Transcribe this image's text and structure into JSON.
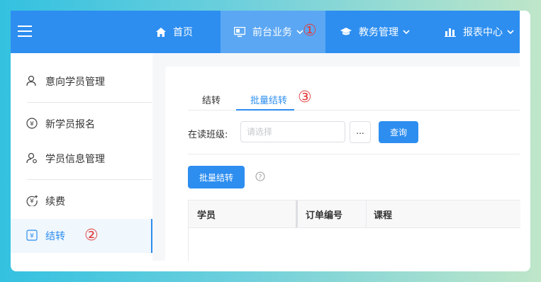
{
  "topnav": {
    "items": [
      {
        "label": "首页",
        "icon": "home-icon"
      },
      {
        "label": "前台业务",
        "icon": "monitor-icon"
      },
      {
        "label": "教务管理",
        "icon": "graduation-cap-icon"
      },
      {
        "label": "报表中心",
        "icon": "bar-chart-icon"
      }
    ],
    "active_index": 1,
    "marker": "①"
  },
  "sidebar": {
    "items": [
      {
        "label": "意向学员管理",
        "icon": "user-icon"
      },
      {
        "label": "新学员报名",
        "icon": "yen-circle-icon"
      },
      {
        "label": "学员信息管理",
        "icon": "user-settings-icon"
      },
      {
        "label": "续费",
        "icon": "yen-plus-icon"
      },
      {
        "label": "结转",
        "icon": "yen-square-icon"
      }
    ],
    "active_index": 4,
    "marker": "②"
  },
  "tabs": {
    "items": [
      {
        "label": "结转"
      },
      {
        "label": "批量结转"
      }
    ],
    "active_index": 1,
    "marker": "③"
  },
  "filter": {
    "label": "在读班级:",
    "placeholder": "请选择",
    "value": "",
    "dots_label": "...",
    "query_label": "查询"
  },
  "actions": {
    "batch_label": "批量结转",
    "help_icon": "question-circle-icon"
  },
  "table": {
    "columns": [
      "学员",
      "订单编号",
      "课程"
    ],
    "rows": []
  },
  "colors": {
    "primary": "#2d8ef0",
    "nav_active": "#5ba7f3",
    "marker_red": "#e23b3b"
  }
}
